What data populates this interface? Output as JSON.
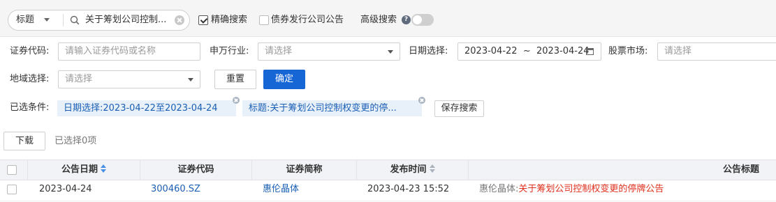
{
  "search": {
    "type_label": "标题",
    "keyword": "关于筹划公司控制...",
    "exact_label": "精确搜索",
    "exact_checked": true,
    "bond_label": "债券发行公司公告",
    "bond_checked": false,
    "advanced_label": "高级搜索"
  },
  "filters": {
    "code_label": "证券代码:",
    "code_placeholder": "请输入证券代码或名称",
    "industry_label": "申万行业:",
    "industry_placeholder": "请选择",
    "date_label": "日期选择:",
    "date_value": "2023-04-22  ~  2023-04-24",
    "market_label": "股票市场:",
    "market_placeholder": "请选择",
    "region_label": "地域选择:",
    "region_placeholder": "请选择",
    "reset_label": "重置",
    "confirm_label": "确定"
  },
  "conditions": {
    "label": "已选条件:",
    "items": [
      {
        "label": "日期选择:",
        "value": "2023-04-22至2023-04-24"
      },
      {
        "label": "标题:",
        "value": "关于筹划公司控制权变更的停..."
      }
    ],
    "save_label": "保存搜索"
  },
  "actions": {
    "download_label": "下载",
    "selected_text": "已选择0项"
  },
  "table": {
    "columns": [
      "公告日期",
      "证券代码",
      "证券简称",
      "发布时间",
      "公告标题"
    ],
    "rows": [
      {
        "date": "2023-04-24",
        "code": "300460.SZ",
        "name": "惠伦晶体",
        "time": "2023-04-23 15:52",
        "title_prefix": "惠伦晶体:",
        "title_main": "关于筹划公司控制权变更的停牌公告"
      }
    ]
  },
  "colors": {
    "primary": "#1766d6",
    "link": "#1a5fb4",
    "highlight": "#e0301e",
    "chip_bg": "#e8f0fa"
  }
}
